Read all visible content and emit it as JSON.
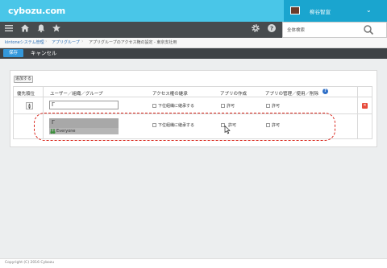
{
  "header": {
    "logo": "cybozu.com",
    "user_name": "柳谷智宣",
    "search_placeholder": "全体検索"
  },
  "breadcrumb": {
    "items": [
      "kintoneシステム管理",
      "アプリグループ",
      "アプリグループのアクセス権の設定 - 東京支社用"
    ]
  },
  "actions": {
    "save_label": "保存",
    "cancel_label": "キャンセル"
  },
  "panel": {
    "add_label": "追加する",
    "columns": [
      "優先順位",
      "ユーザー／組織／グループ",
      "アクセス権の継承",
      "アプリの作成",
      "アプリの管理／使用／削除"
    ],
    "rows": [
      {
        "priority_control": "▲▼",
        "user_value": "",
        "inherit_label": "下位組織に継承する",
        "create_label": "許可",
        "manage_label": "許可"
      },
      {
        "user_value": "",
        "group_name": "Everyone",
        "inherit_label": "下位組織に継承する",
        "create_label": "許可",
        "manage_label": "許可"
      }
    ]
  },
  "footer": {
    "copyright": "Copyright (C) 2016 Cybozu"
  },
  "colors": {
    "topbar": "#49c6e8",
    "user_box": "#1aa5cf",
    "navbar": "#474b4e",
    "save": "#3498db",
    "delete": "#e74c3c",
    "highlight": "#d9261c"
  }
}
